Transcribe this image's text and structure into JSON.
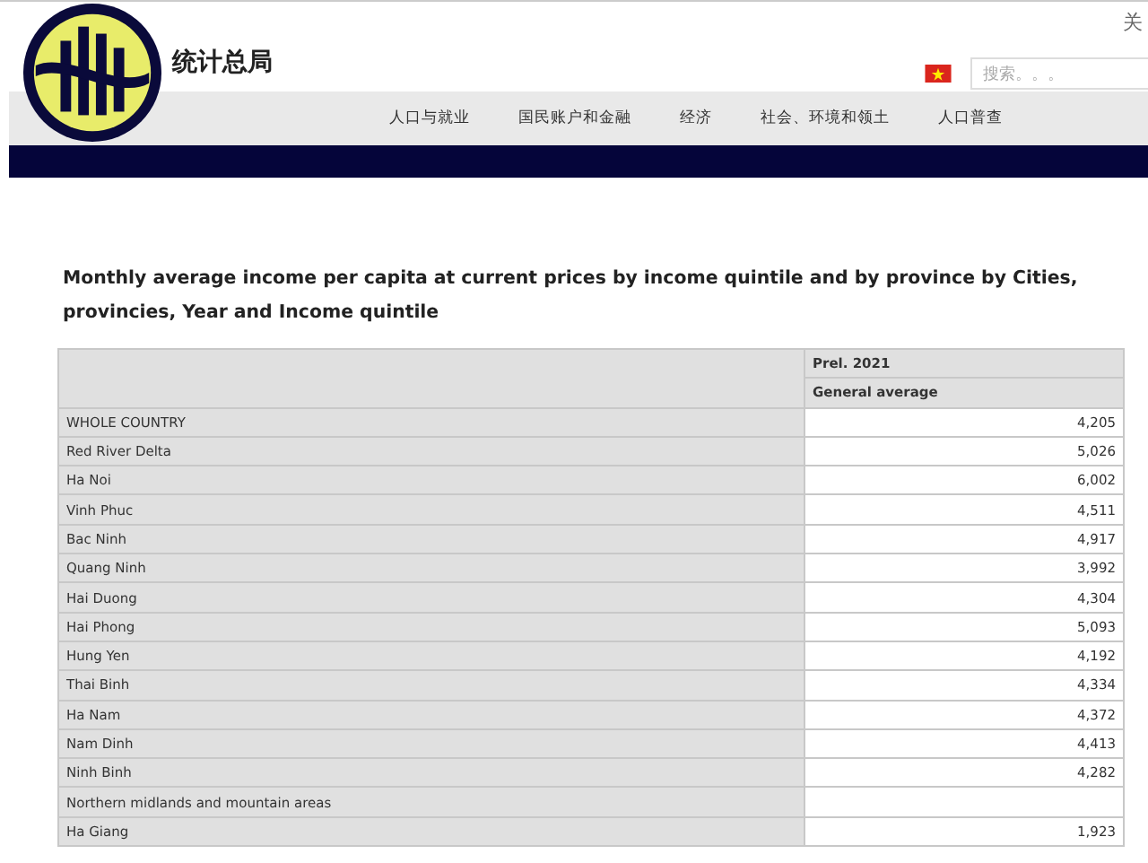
{
  "header": {
    "site_title": "统计总局",
    "top_link": "关",
    "search": {
      "placeholder": "搜索。。。"
    },
    "nav": [
      "人口与就业",
      "国民账户和金融",
      "经济",
      "社会、环境和领土",
      "人口普查"
    ]
  },
  "table_title": "Monthly average income per capita at current prices by income quintile and by province by Cities, provincies, Year and Income quintile",
  "table": {
    "header": [
      "Prel. 2021",
      "General average"
    ],
    "rows": [
      {
        "name": "WHOLE COUNTRY",
        "value": "4,205"
      },
      {
        "name": "Red River Delta",
        "value": "5,026"
      },
      {
        "name": "Ha Noi",
        "value": "6,002"
      },
      {
        "name": "Vinh Phuc",
        "value": "4,511"
      },
      {
        "name": "Bac Ninh",
        "value": "4,917"
      },
      {
        "name": "Quang Ninh",
        "value": "3,992"
      },
      {
        "name": "Hai Duong",
        "value": "4,304"
      },
      {
        "name": "Hai Phong",
        "value": "5,093"
      },
      {
        "name": "Hung Yen",
        "value": "4,192"
      },
      {
        "name": "Thai Binh",
        "value": "4,334"
      },
      {
        "name": "Ha Nam",
        "value": "4,372"
      },
      {
        "name": "Nam Dinh",
        "value": "4,413"
      },
      {
        "name": "Ninh Binh",
        "value": "4,282"
      },
      {
        "name": "Northern midlands and mountain areas"
      },
      {
        "name": "Ha Giang",
        "value": "1,923"
      }
    ]
  }
}
